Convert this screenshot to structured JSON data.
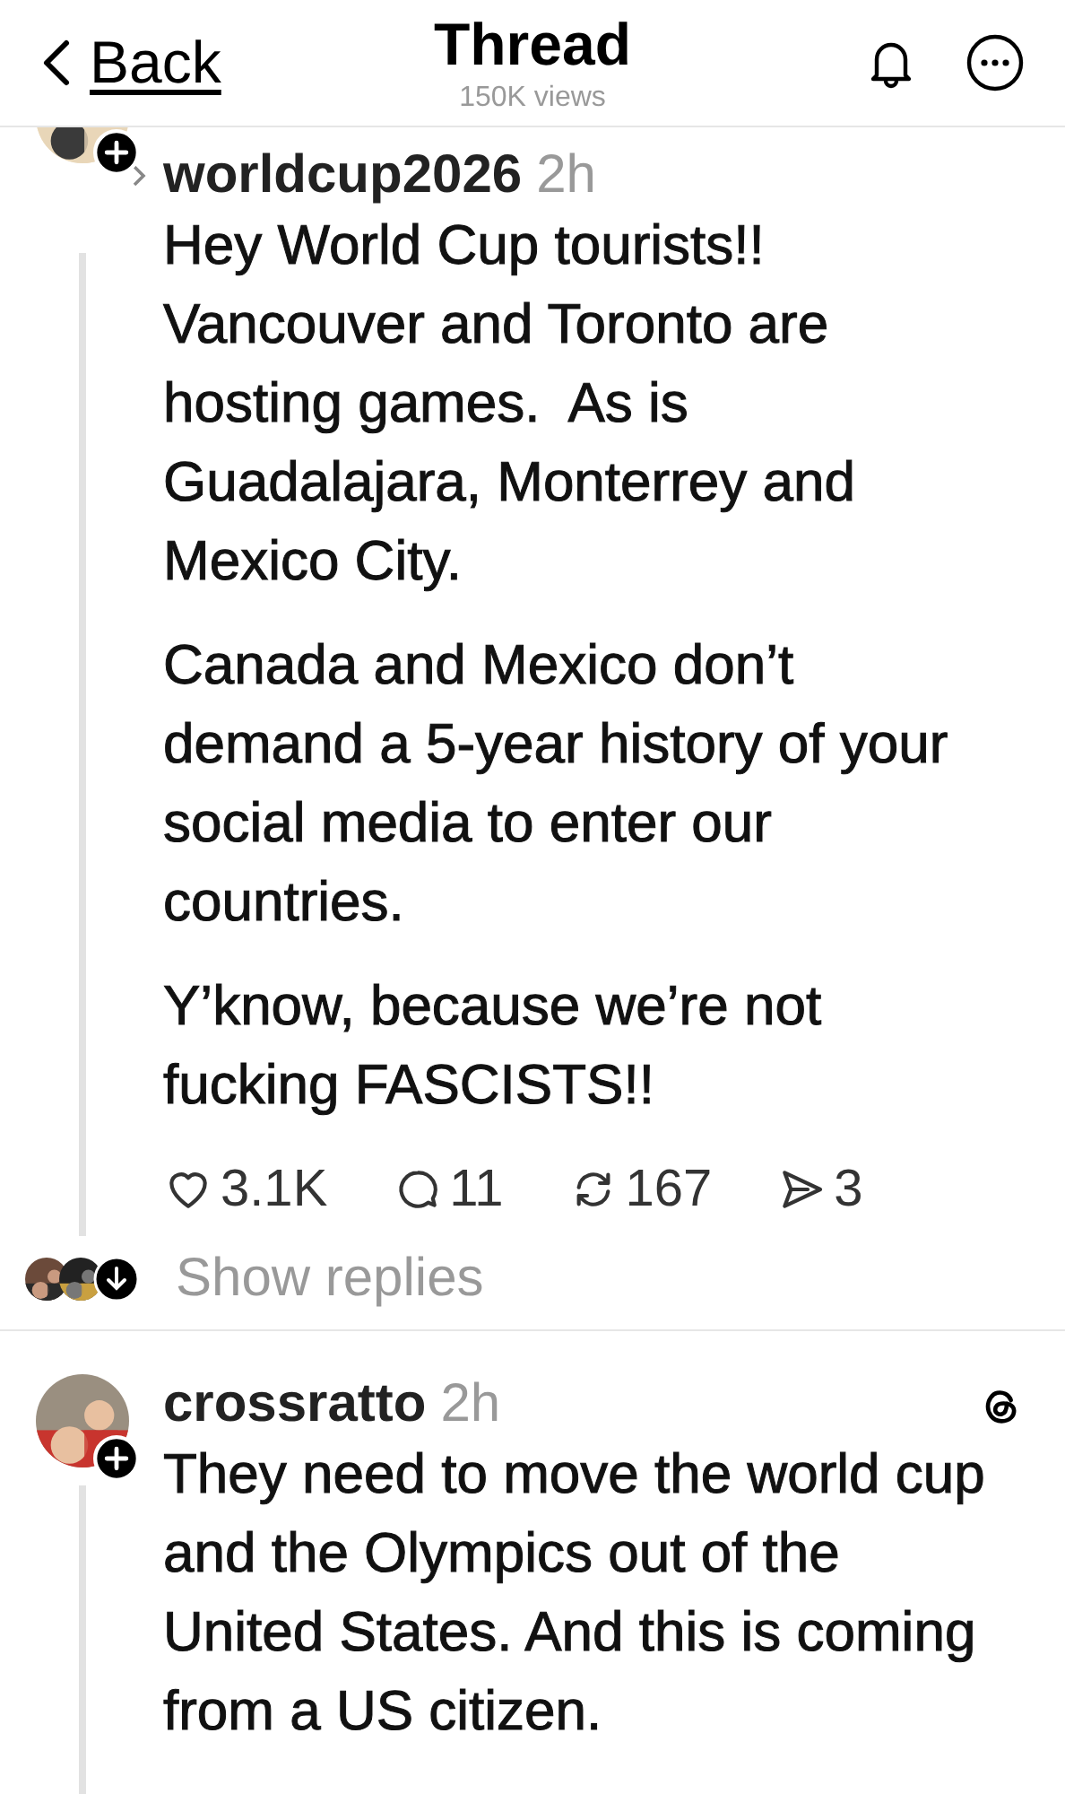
{
  "header": {
    "back": "Back",
    "title": "Thread",
    "views": "150K views"
  },
  "post": {
    "username": "worldcup2026",
    "time": "2h",
    "paragraphs": [
      "Hey World Cup tourists!! Vancouver and Toronto are hosting games.  As is Guadalajara, Monterrey and Mexico City.",
      "Canada and Mexico don’t demand a 5-year history of your social media to enter our countries.",
      "Y’know, because we’re not fucking FASCISTS!!"
    ],
    "actions": [
      {
        "kind": "like",
        "count": "3.1K"
      },
      {
        "kind": "reply",
        "count": "11"
      },
      {
        "kind": "repost",
        "count": "167"
      },
      {
        "kind": "share",
        "count": "3"
      }
    ],
    "show_replies": "Show replies"
  },
  "reply": {
    "username": "crossratto",
    "time": "2h",
    "text": "They need to move the world cup and the Olympics out of the United States. And this is coming from a US citizen."
  }
}
